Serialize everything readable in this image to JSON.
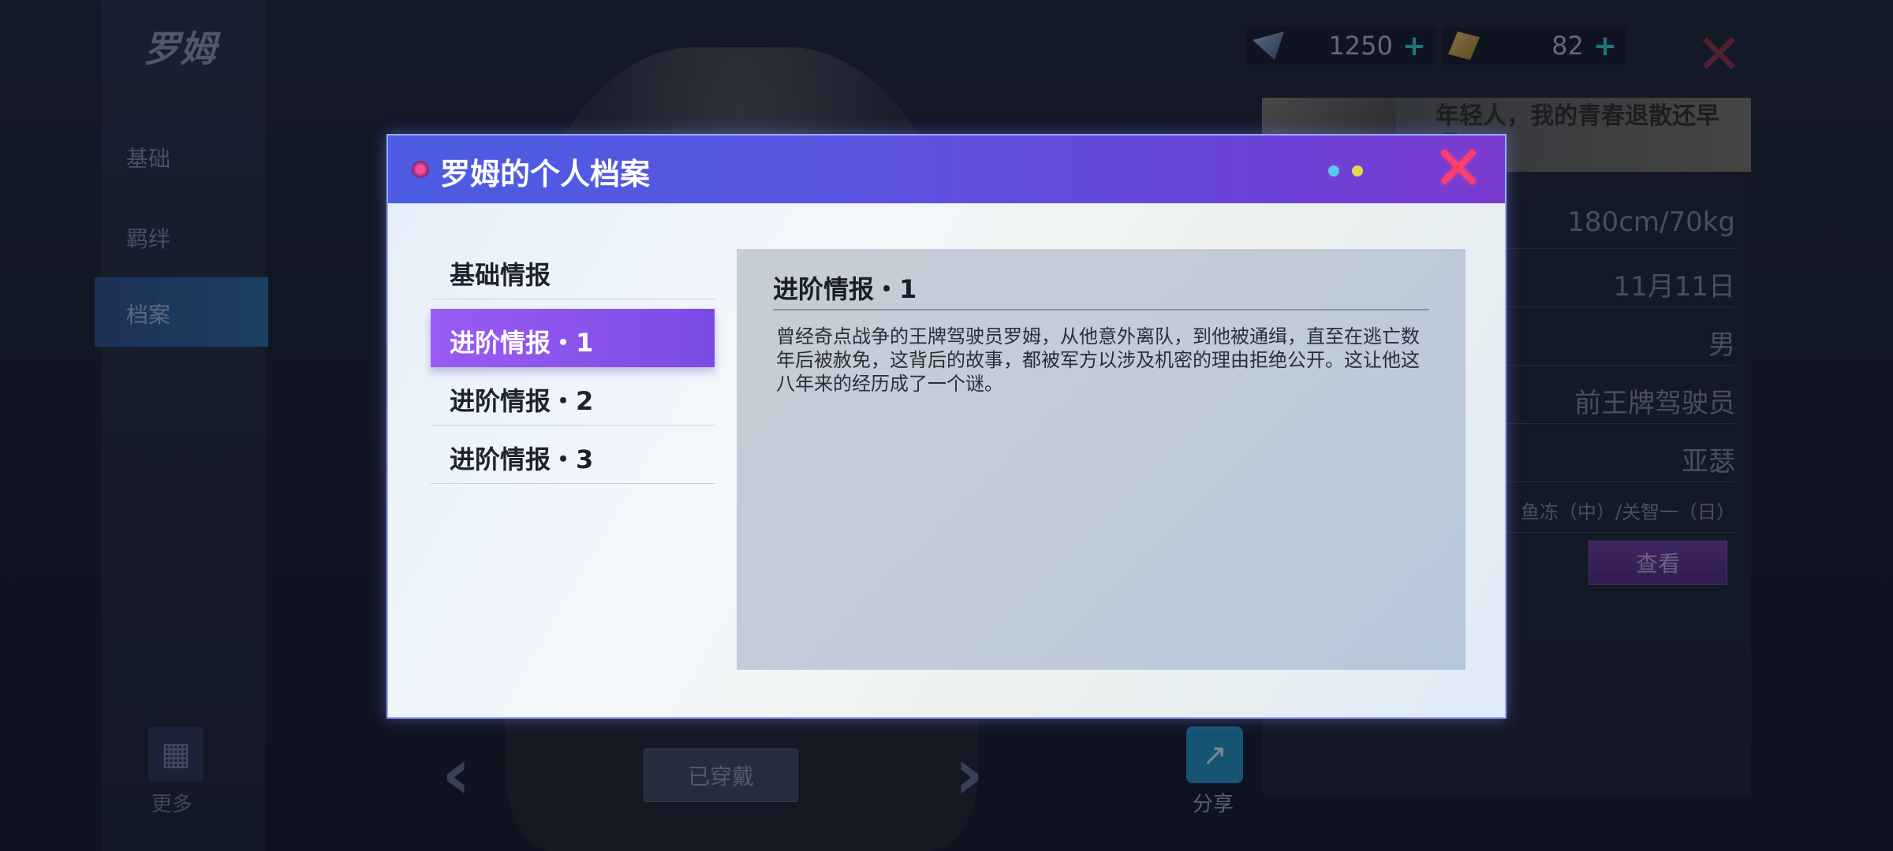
{
  "background": {
    "character_name": "罗姆",
    "side_tabs": [
      "基础",
      "羁绊",
      "档案"
    ],
    "more_label": "更多",
    "worn_label": "已穿戴",
    "share_label": "分享",
    "currency": [
      {
        "icon": "crystal-icon",
        "value": "1250"
      },
      {
        "icon": "ticket-icon",
        "value": "82"
      }
    ],
    "speech": "年轻人，我的青春退散还早呢！",
    "info": [
      "180cm/70kg",
      "11月11日",
      "男",
      "前王牌驾驶员",
      "亚瑟",
      "鱼冻（中）/关智一（日）"
    ],
    "view_label": "查看"
  },
  "modal": {
    "title": "罗姆的个人档案",
    "menu": [
      "基础情报",
      "进阶情报・1",
      "进阶情报・2",
      "进阶情报・3"
    ],
    "active_index": 1,
    "content_title": "进阶情报・1",
    "content_text": "曾经奇点战争的王牌驾驶员罗姆，从他意外离队，到他被通缉，直至在逃亡数年后被赦免，这背后的故事，都被军方以涉及机密的理由拒绝公开。这让他这八年来的经历成了一个谜。"
  },
  "colors": {
    "header_start": "#4b5ce3",
    "header_end": "#7a3ad0",
    "active_tab": "#8a54ec",
    "close": "#ff3d6e"
  }
}
